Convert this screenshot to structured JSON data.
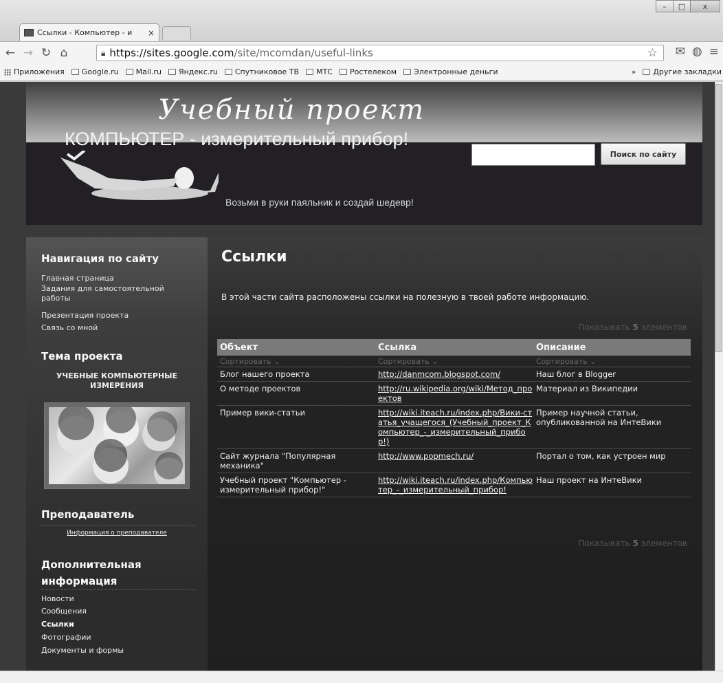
{
  "browser": {
    "tab_title": "Ссылки - Компьютер - и",
    "tab_close": "×",
    "url_host": "https://sites.google.com",
    "url_path": "/site/mcomdan/useful-links",
    "win_min": "–",
    "win_max": "□",
    "win_close": "x",
    "bookmarks": [
      "Приложения",
      "Google.ru",
      "Mail.ru",
      "Яндекс.ru",
      "Спутниковое ТВ",
      "МТС",
      "Ростелеком",
      "Электронные деньги"
    ],
    "bookmarks_more": "»",
    "other_bookmarks": "Другие закладки"
  },
  "header": {
    "script_title": "Учебный проект",
    "big_title": "КОМПЬЮТЕР - измерительный прибор!",
    "slogan": "Возьми в руки паяльник и создай шедевр!",
    "search_button": "Поиск по сайту",
    "search_value": ""
  },
  "sidebar": {
    "nav_heading": "Навигация по сайту",
    "nav_items": [
      "Главная страница",
      "Задания для самостоятельной работы",
      "Презентация проекта",
      "Связь со мной"
    ],
    "topic_heading": "Тема проекта",
    "topic_text": "УЧЕБНЫЕ КОМПЬЮТЕРНЫЕ ИЗМЕРЕНИЯ",
    "teacher_heading": "Преподаватель",
    "teacher_link": "Информация о преподавателе",
    "extra_heading": "Дополнительная информация",
    "extra_items": [
      "Новости",
      "Сообщения",
      "Ссылки",
      "Фотографии",
      "Документы и формы"
    ]
  },
  "main": {
    "title": "Ссылки",
    "intro": "В этой части сайта расположены ссылки на полезную в твоей работе информацию.",
    "show_prefix": "Показывать",
    "show_count": "5",
    "show_suffix": "элементов",
    "columns": [
      "Объект",
      "Ссылка",
      "Описание"
    ],
    "sort_label": "Сортировать",
    "rows": [
      {
        "object": "Блог нашего проекта",
        "link": "http://danmcom.blogspot.com/",
        "description": "Наш блог в Blogger"
      },
      {
        "object": "О методе проектов",
        "link": "http://ru.wikipedia.org/wiki/Метод_проектов",
        "description": "Материал из Википедии"
      },
      {
        "object": "Пример вики-статьи",
        "link": "http://wiki.iteach.ru/index.php/Вики-статья_учащегося_(Учебный_проект_Компьютер_-_измерительный_прибор!)",
        "description": "Пример научной статьи, опубликованной на ИнтеВики"
      },
      {
        "object": "Сайт журнала \"Популярная механика\"",
        "link": "http://www.popmech.ru/",
        "description": "Портал о том, как устроен мир"
      },
      {
        "object": "Учебный проект \"Компьютер - измерительный прибор!\"",
        "link": "http://wiki.iteach.ru/index.php/Компьютер_-_измерительный_прибор!",
        "description": "Наш проект на ИнтеВики"
      }
    ]
  }
}
